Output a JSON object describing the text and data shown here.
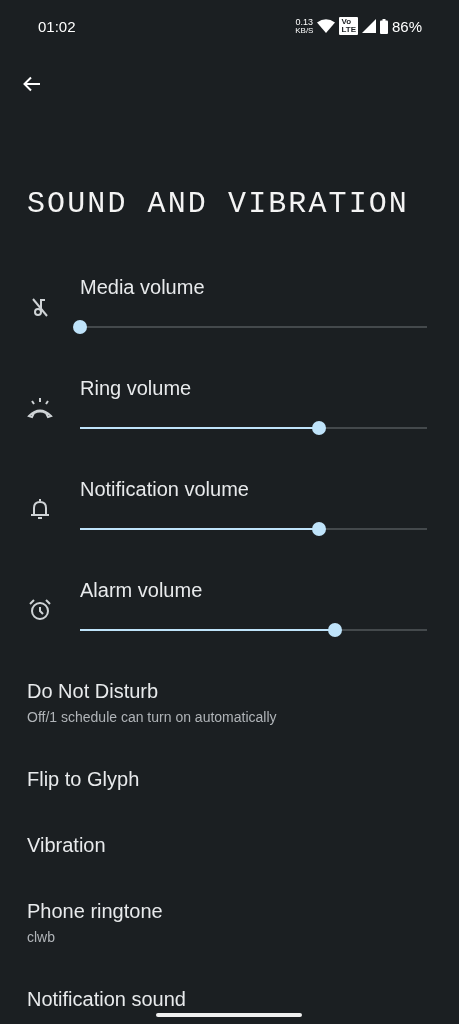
{
  "status_bar": {
    "time": "01:02",
    "speed": "0.13",
    "speed_unit": "KB/S",
    "volte_top": "Vo",
    "volte_bottom": "LTE",
    "battery": "86%"
  },
  "title": "SOUND AND VIBRATION",
  "sliders": [
    {
      "label": "Media volume",
      "level": 0
    },
    {
      "label": "Ring volume",
      "level": 0.69
    },
    {
      "label": "Notification volume",
      "level": 0.69
    },
    {
      "label": "Alarm volume",
      "level": 0.735
    }
  ],
  "items": [
    {
      "title": "Do Not Disturb",
      "summary": "Off/1 schedule can turn on automatically"
    },
    {
      "title": "Flip to Glyph"
    },
    {
      "title": "Vibration"
    },
    {
      "title": "Phone ringtone",
      "summary": "clwb"
    },
    {
      "title": "Notification sound"
    }
  ]
}
